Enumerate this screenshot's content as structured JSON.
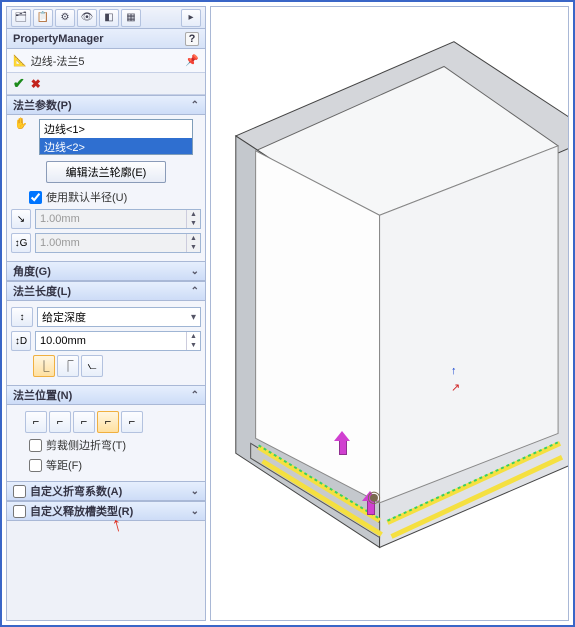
{
  "pm_header": "PropertyManager",
  "feature_name": "边线-法兰5",
  "flange_params": {
    "title": "法兰参数(P)",
    "edges": [
      "边线<1>",
      "边线<2>"
    ],
    "edit_profile_btn": "编辑法兰轮廓(E)",
    "use_default_radius": "使用默认半径(U)",
    "bend_radius": "1.00mm",
    "gap": "1.00mm"
  },
  "angle": {
    "title": "角度(G)"
  },
  "length": {
    "title": "法兰长度(L)",
    "end_condition": "给定深度",
    "value": "10.00mm"
  },
  "position": {
    "title": "法兰位置(N)",
    "trim_side_bends": "剪裁侧边折弯(T)",
    "offset": "等距(F)"
  },
  "custom_bend": {
    "title": "自定义折弯系数(A)"
  },
  "custom_relief": {
    "title": "自定义释放槽类型(R)"
  }
}
